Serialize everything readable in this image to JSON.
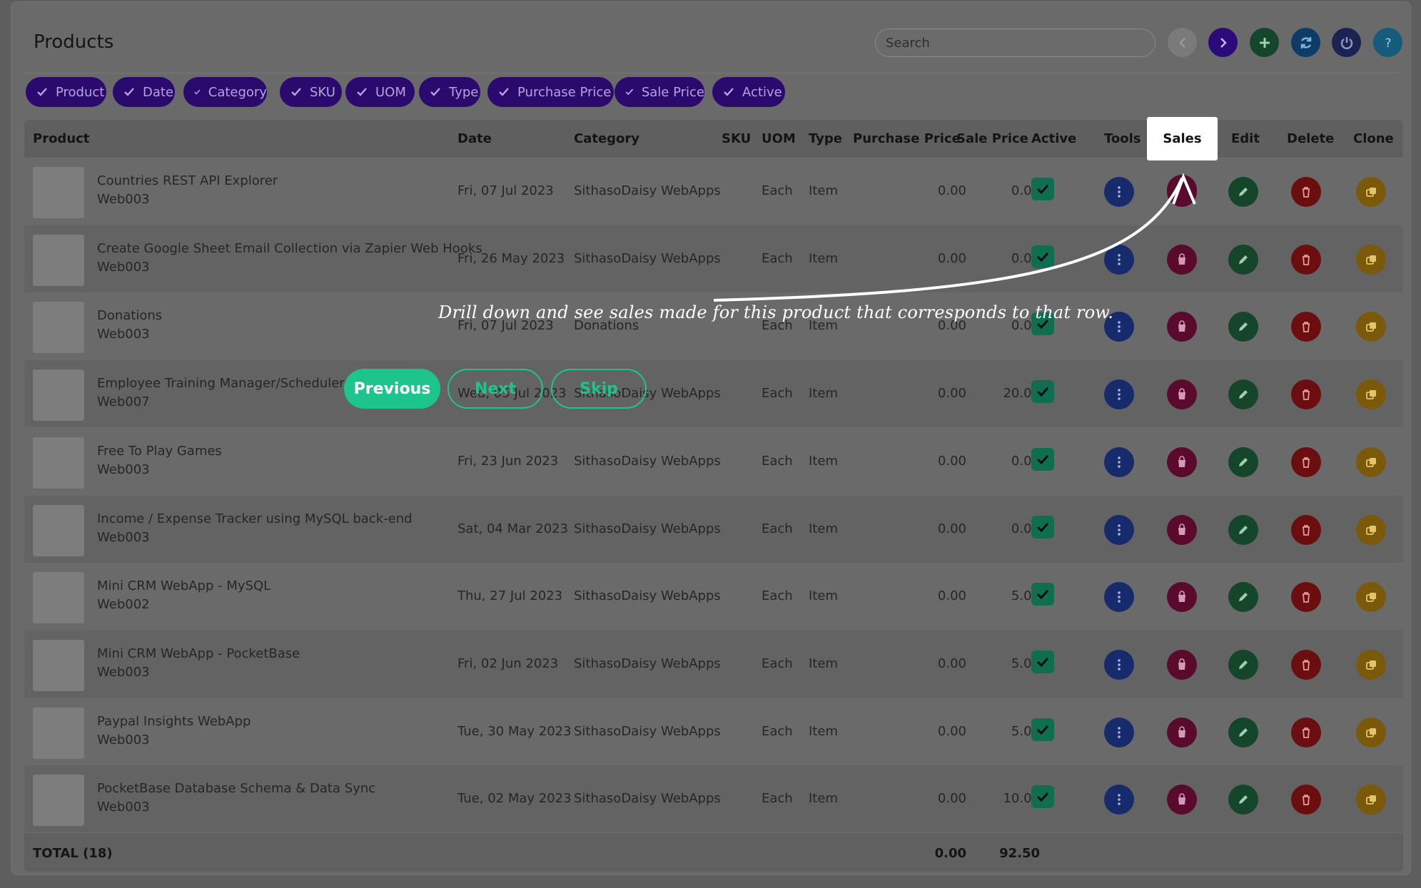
{
  "header": {
    "title": "Products",
    "search_placeholder": "Search"
  },
  "toolbar": [
    {
      "name": "back-button",
      "icon": "chevron-left-icon",
      "color": "#7a7a7a"
    },
    {
      "name": "forward-button",
      "icon": "chevron-right-icon",
      "color": "#2b0a7a"
    },
    {
      "name": "add-button",
      "icon": "plus-icon",
      "color": "#15452a"
    },
    {
      "name": "refresh-button",
      "icon": "refresh-icon",
      "color": "#0e3c66"
    },
    {
      "name": "logout-button",
      "icon": "power-icon",
      "color": "#1a2352"
    },
    {
      "name": "help-button",
      "icon": "question-icon",
      "color": "#145b7c"
    }
  ],
  "chips": [
    "Product",
    "Date",
    "Category",
    "SKU",
    "UOM",
    "Type",
    "Purchase Price",
    "Sale Price",
    "Active"
  ],
  "columns": [
    "Product",
    "Date",
    "Category",
    "SKU",
    "UOM",
    "Type",
    "Purchase Price",
    "Sale Price",
    "Active",
    "Tools",
    "Sales",
    "Edit",
    "Delete",
    "Clone"
  ],
  "rows": [
    {
      "name": "Countries REST API Explorer",
      "sku": "Web003",
      "date": "Fri, 07 Jul 2023",
      "category": "SithasoDaisy WebApps",
      "uom": "Each",
      "type": "Item",
      "purchase": "0.00",
      "sale": "0.00"
    },
    {
      "name": "Create Google Sheet Email Collection via Zapier Web Hooks",
      "sku": "Web003",
      "date": "Fri, 26 May 2023",
      "category": "SithasoDaisy WebApps",
      "uom": "Each",
      "type": "Item",
      "purchase": "0.00",
      "sale": "0.00"
    },
    {
      "name": "Donations",
      "sku": "Web003",
      "date": "Fri, 07 Jul 2023",
      "category": "Donations",
      "uom": "Each",
      "type": "Item",
      "purchase": "0.00",
      "sale": "0.00"
    },
    {
      "name": "Employee Training Manager/Scheduler",
      "sku": "Web007",
      "date": "Wed, 05 Jul 2023",
      "category": "SithasoDaisy WebApps",
      "uom": "Each",
      "type": "Item",
      "purchase": "0.00",
      "sale": "20.00"
    },
    {
      "name": "Free To Play Games",
      "sku": "Web003",
      "date": "Fri, 23 Jun 2023",
      "category": "SithasoDaisy WebApps",
      "uom": "Each",
      "type": "Item",
      "purchase": "0.00",
      "sale": "0.00"
    },
    {
      "name": "Income / Expense Tracker using MySQL back-end",
      "sku": "Web003",
      "date": "Sat, 04 Mar 2023",
      "category": "SithasoDaisy WebApps",
      "uom": "Each",
      "type": "Item",
      "purchase": "0.00",
      "sale": "0.00"
    },
    {
      "name": "Mini CRM WebApp - MySQL",
      "sku": "Web002",
      "date": "Thu, 27 Jul 2023",
      "category": "SithasoDaisy WebApps",
      "uom": "Each",
      "type": "Item",
      "purchase": "0.00",
      "sale": "5.00"
    },
    {
      "name": "Mini CRM WebApp - PocketBase",
      "sku": "Web003",
      "date": "Fri, 02 Jun 2023",
      "category": "SithasoDaisy WebApps",
      "uom": "Each",
      "type": "Item",
      "purchase": "0.00",
      "sale": "5.00"
    },
    {
      "name": "Paypal Insights WebApp",
      "sku": "Web003",
      "date": "Tue, 30 May 2023",
      "category": "SithasoDaisy WebApps",
      "uom": "Each",
      "type": "Item",
      "purchase": "0.00",
      "sale": "5.00"
    },
    {
      "name": "PocketBase Database Schema & Data Sync",
      "sku": "Web003",
      "date": "Tue, 02 May 2023",
      "category": "SithasoDaisy WebApps",
      "uom": "Each",
      "type": "Item",
      "purchase": "0.00",
      "sale": "10.00"
    }
  ],
  "footer": {
    "label": "TOTAL (18)",
    "purchase_total": "0.00",
    "sale_total": "92.50"
  },
  "tour": {
    "text": "Drill down and see sales made for this product that corresponds to that row.",
    "previous_label": "Previous",
    "next_label": "Next",
    "skip_label": "Skip"
  },
  "colors": {
    "chip": "#2b0a6e",
    "tools": "#172a6b",
    "sales": "#5a0a2c",
    "edit": "#15452a",
    "delete": "#6b0e10",
    "clone": "#7a5a0a",
    "active": "#0f6e4f",
    "tour_accent": "#1dc58c"
  }
}
